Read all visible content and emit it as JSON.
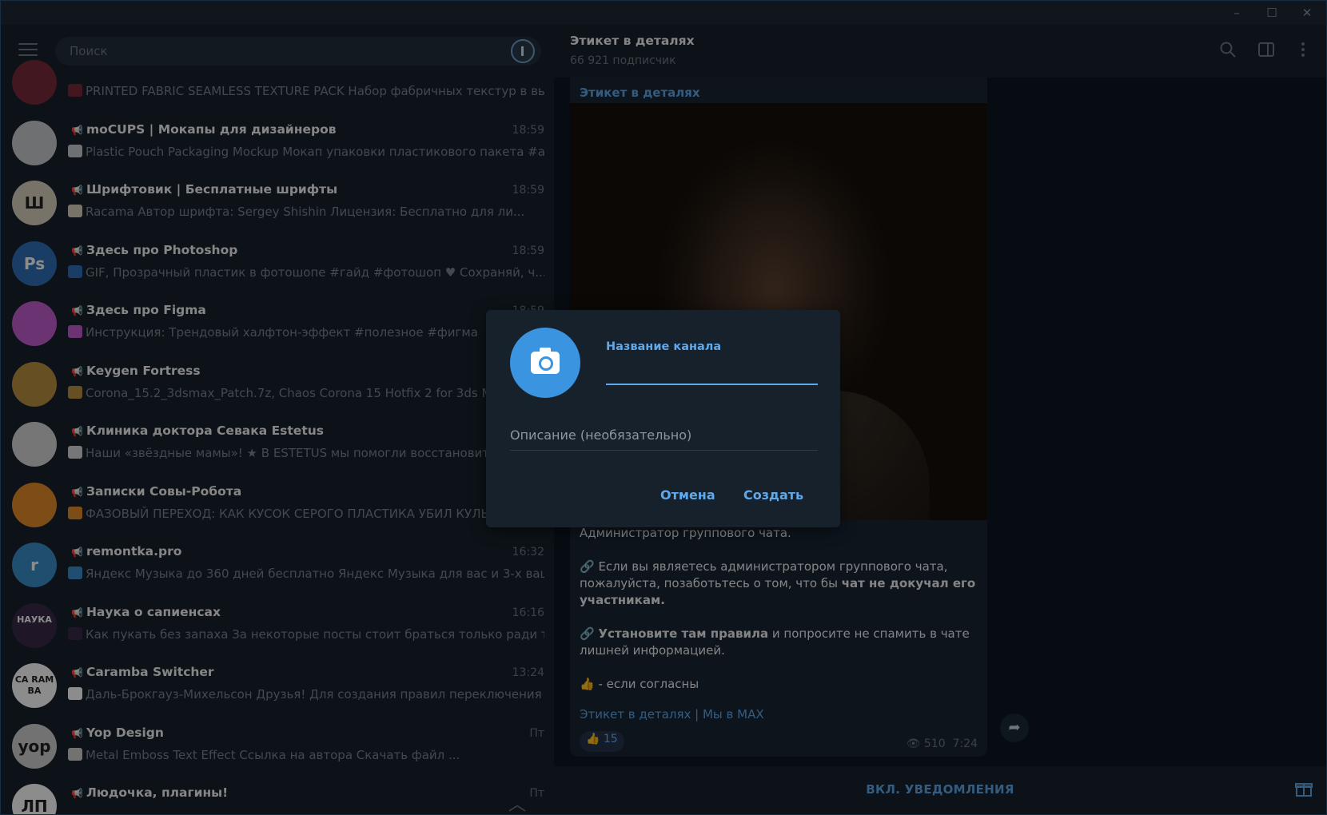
{
  "window": {
    "minimize_glyph": "–",
    "maximize_glyph": "☐",
    "close_glyph": "✕"
  },
  "search": {
    "placeholder": "Поиск"
  },
  "chats": [
    {
      "name": "",
      "time": "",
      "preview": "PRINTED FABRIC SEAMLESS TEXTURE PACK  Набор фабричных текстур в вы...",
      "avatar_color": "#7a2a3a",
      "avatar_text": ""
    },
    {
      "name": "moCUPS | Мокапы для дизайнеров",
      "time": "18:59",
      "preview": "Plastic Pouch Packaging Mockup  Мокап упаковки пластикового пакета  #a...",
      "avatar_color": "#c9ccd0",
      "avatar_text": ""
    },
    {
      "name": "Шрифтовик | Бесплатные шрифты",
      "time": "18:59",
      "preview": "Racama  Автор шрифта: Sergey Shishin Лицензия: Бесплатно для ли...",
      "avatar_color": "#d9d2c0",
      "avatar_text": "Ш"
    },
    {
      "name": "Здесь про Photoshop",
      "time": "18:59",
      "preview": "GIF,  Прозрачный пластик в фотошопе #гайд #фотошоп  ♥ Сохраняй, ч...",
      "avatar_color": "#2f6fb6",
      "avatar_text": "Ps"
    },
    {
      "name": "Здесь про Figma",
      "time": "18:59",
      "preview": "Инструкция: Трендовый халфтон-эффект #полезное #фигма",
      "avatar_color": "#c45ed0",
      "avatar_text": ""
    },
    {
      "name": "Keygen Fortress",
      "time": "",
      "preview": "Corona_15.2_3dsmax_Patch.7z, Chaos Corona 15 Hotfix 2 for 3ds Max",
      "avatar_color": "#b89040",
      "avatar_text": ""
    },
    {
      "name": "Клиника доктора Севака Estetus",
      "time": "",
      "preview": "Наши «звёздные мамы»! ★ В ESTETUS мы помогли восстановить",
      "avatar_color": "#d8d8d8",
      "avatar_text": ""
    },
    {
      "name": "Записки Совы-Робота",
      "time": "",
      "preview": "ФАЗОВЫЙ ПЕРЕХОД: КАК КУСОК СЕРОГО ПЛАСТИКА УБИЛ КУЛЬТ",
      "avatar_color": "#e38a2b",
      "avatar_text": ""
    },
    {
      "name": "remontka.pro",
      "time": "16:32",
      "preview": "Яндекс Музыка до 360 дней бесплатно  Яндекс Музыка для вас и 3-х ваш...",
      "avatar_color": "#3a8fc9",
      "avatar_text": "r"
    },
    {
      "name": "Наука о сапиенсах",
      "time": "16:16",
      "preview": "Как пукать без запаха  За некоторые посты стоит браться только ради та...",
      "avatar_color": "#3a2a4a",
      "avatar_text": "НАУКА"
    },
    {
      "name": "Caramba Switcher",
      "time": "13:24",
      "preview": "Даль-Брокгауз-Михельсон  Друзья! Для создания правил переключения ...",
      "avatar_color": "#ffffff",
      "avatar_text": "CA RAM BA"
    },
    {
      "name": "Yop Design",
      "time": "Пт",
      "preview": "Metal Emboss Text Effect  Ссылка на автора  Скачать файл ...",
      "avatar_color": "#d0d0d0",
      "avatar_text": "yop"
    },
    {
      "name": "Людочка, плагины!",
      "time": "Пт",
      "preview": "",
      "avatar_color": "#ffffff",
      "avatar_text": "ЛП"
    }
  ],
  "header": {
    "title": "Этикет в деталях",
    "subscribers": "66 921 подписчик"
  },
  "message": {
    "channel_name": "Этикет в деталях",
    "para1": "Администратор группового чата.",
    "para2_a": "Если вы являетесь администратором группового чата, пожалуйста, позаботьтесь о том, что бы ",
    "para2_b": "чат не докучал его участникам.",
    "para3_a": "Установите там правила",
    "para3_b": " и попросите не спамить в чате лишней информацией.",
    "para4": "- если согласны",
    "links": "Этикет в деталях | Мы в MAX",
    "reaction": "👍 15",
    "views": "510",
    "time": "7:24"
  },
  "bottom": {
    "notifications_label": "ВКЛ. УВЕДОМЛЕНИЯ"
  },
  "dialog": {
    "name_label": "Название канала",
    "name_value": "",
    "description_placeholder": "Описание (необязательно)",
    "cancel_label": "Отмена",
    "create_label": "Создать"
  },
  "colors": {
    "accent": "#5fa8ea",
    "background": "#0e1621",
    "panel": "#17212b"
  }
}
